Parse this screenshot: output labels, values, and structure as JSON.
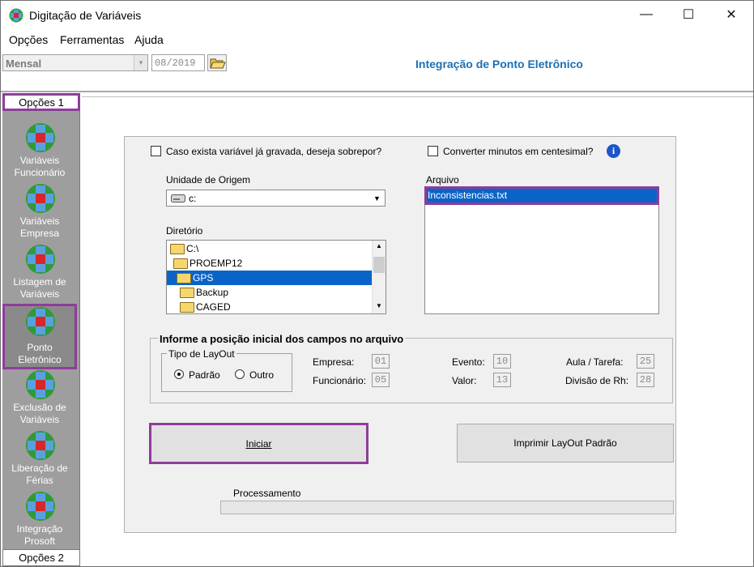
{
  "window": {
    "title": "Digitação de Variáveis"
  },
  "window_controls": {
    "minimize": "—",
    "maximize": "☐",
    "close": "✕"
  },
  "menu": [
    {
      "label": "Opções"
    },
    {
      "label": "Ferramentas"
    },
    {
      "label": "Ajuda"
    }
  ],
  "toolbar": {
    "period_select": "Mensal",
    "competence": "08/2019",
    "heading": "Integração de Ponto Eletrônico"
  },
  "sidebar": {
    "header": "Opções 1",
    "footer": "Opções 2",
    "items": [
      {
        "label": "Variáveis Funcionário",
        "icon": "wolters-logo-icon"
      },
      {
        "label": "Variáveis Empresa",
        "icon": "wolters-logo-icon"
      },
      {
        "label": "Listagem de Variáveis",
        "icon": "wolters-logo-icon"
      },
      {
        "label": "Ponto Eletrônico",
        "icon": "wolters-logo-icon",
        "selected": true
      },
      {
        "label": "Exclusão de Variáveis",
        "icon": "wolters-logo-icon"
      },
      {
        "label": "Liberação de Férias",
        "icon": "wolters-logo-icon"
      },
      {
        "label": "Integração Prosoft",
        "icon": "wolters-logo-icon"
      }
    ]
  },
  "options": {
    "overwrite_label": "Caso exista variável já gravada, deseja sobrepor?",
    "overwrite_checked": false,
    "centesimal_label": "Converter minutos em centesimal?",
    "centesimal_checked": false
  },
  "source": {
    "drive_label": "Unidade de Origem",
    "drive_value": "c:",
    "dir_label": "Diretório",
    "dirs": [
      "C:\\",
      "PROEMP12",
      "GPS",
      "Backup",
      "CAGED"
    ],
    "selected_dir": "GPS"
  },
  "file": {
    "label": "Arquivo",
    "files": [
      "Inconsistencias.txt"
    ]
  },
  "positions": {
    "title": "Informe a posição inicial dos campos no arquivo",
    "layout_title": "Tipo de LayOut",
    "radio_default": "Padrão",
    "radio_other": "Outro",
    "selected_layout": "Padrão",
    "fields": {
      "empresa_label": "Empresa:",
      "empresa": "01",
      "funcionario_label": "Funcionário:",
      "funcionario": "05",
      "evento_label": "Evento:",
      "evento": "10",
      "valor_label": "Valor:",
      "valor": "13",
      "aula_label": "Aula / Tarefa:",
      "aula": "25",
      "divisao_label": "Divisão de Rh:",
      "divisao": "28"
    }
  },
  "actions": {
    "start": "Iniciar",
    "print_layout": "Imprimir LayOut Padrão"
  },
  "processing": {
    "label": "Processamento",
    "progress": 0
  }
}
